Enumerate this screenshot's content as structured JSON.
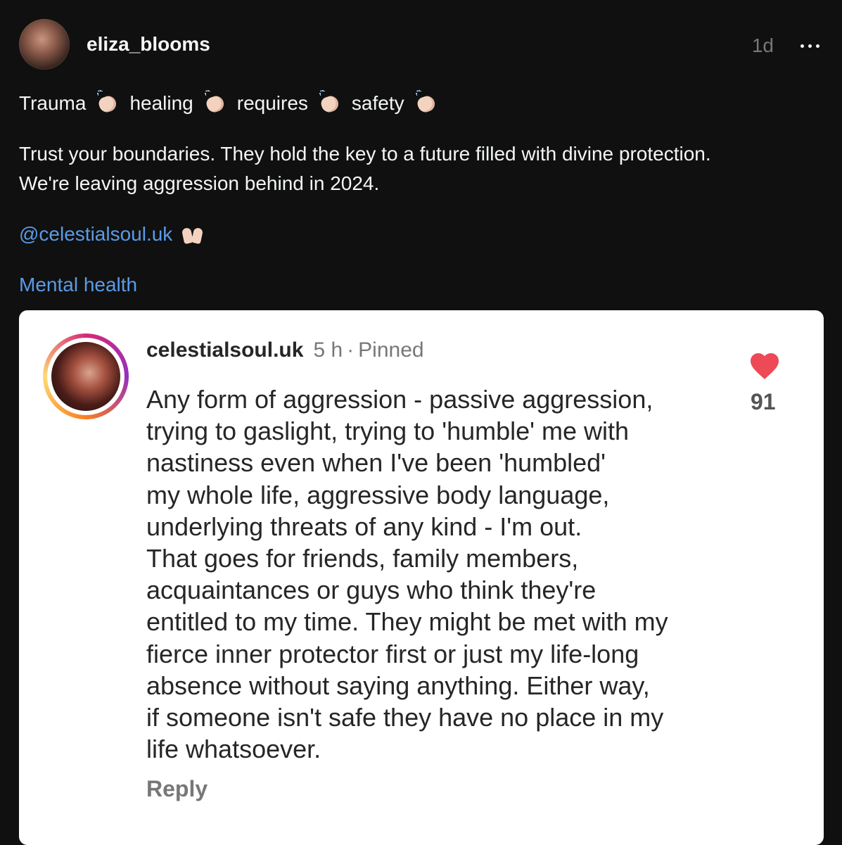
{
  "post": {
    "username": "eliza_blooms",
    "time": "1d",
    "headline_words": [
      "Trauma",
      "healing",
      "requires",
      "safety"
    ],
    "body_lines": [
      "Trust your boundaries. They hold the key to a future filled with divine protection.",
      "We're leaving aggression behind in 2024."
    ],
    "mention": "@celestialsoul.uk",
    "topic_tag": "Mental health",
    "icons": {
      "clap": "clapping-hands-icon",
      "raise": "raising-hands-icon",
      "more": "more-options-icon"
    }
  },
  "comment": {
    "username": "celestialsoul.uk",
    "time": "5 h",
    "separator": "·",
    "pinned": "Pinned",
    "likes": "91",
    "reply": "Reply",
    "heart_color": "#ed4956",
    "lines": [
      "Any form of aggression - passive aggression,",
      "trying to gaslight, trying to 'humble' me with",
      "nastiness even when I've been 'humbled'",
      "my whole life, aggressive body language,",
      "underlying threats of any kind - I'm out.",
      "That goes for friends, family members,",
      "acquaintances or guys who think they're",
      "entitled to my time. They might be met with my",
      "fierce inner protector first or just my life-long",
      "absence without saying anything. Either way,",
      "if someone isn't safe they have no place in my",
      "life whatsoever."
    ]
  },
  "colors": {
    "background": "#101010",
    "link": "#5a9be6",
    "card": "#ffffff"
  }
}
